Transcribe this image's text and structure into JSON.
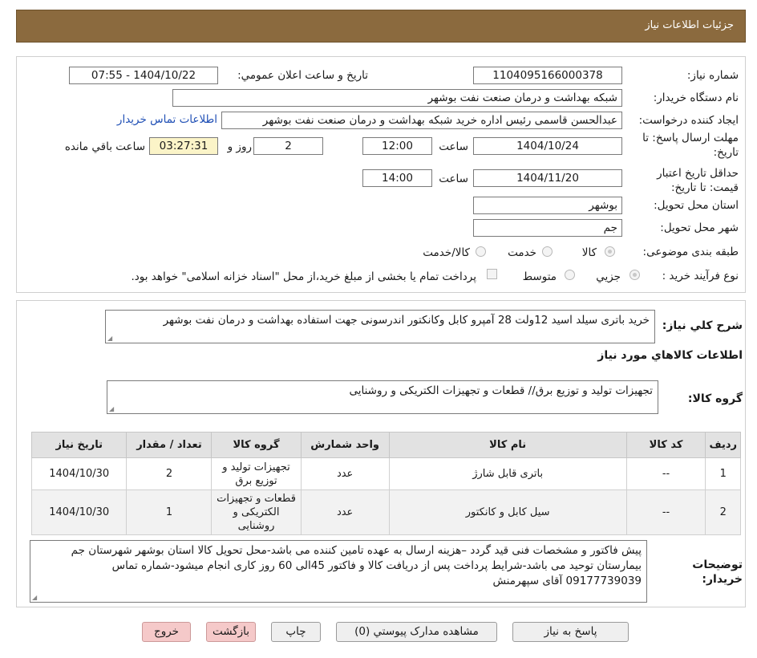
{
  "header": {
    "title": "جزئیات اطلاعات نیاز"
  },
  "form": {
    "need_number_label": "شماره نیاز:",
    "need_number": "1104095166000378",
    "announce_label": "تاريخ و ساعت اعلان عمومي:",
    "announce_value": "1404/10/22 - 07:55",
    "buyer_org_label": "نام دستگاه خريدار:",
    "buyer_org": "شبکه بهداشت و درمان صنعت نفت بوشهر",
    "creator_label": "ايجاد کننده درخواست:",
    "creator": "عبدالحسن قاسمی رئیس اداره خرید  شبکه بهداشت و درمان صنعت نفت بوشهر",
    "contact_link": "اطلاعات تماس خریدار",
    "deadline_label": "مهلت ارسال پاسخ: تا تاريخ:",
    "deadline_date": "1404/10/24",
    "time_label": "ساعت",
    "deadline_time": "12:00",
    "days_value": "2",
    "days_label": "روز و",
    "remaining_time": "03:27:31",
    "remaining_label": "ساعت باقي مانده",
    "validity_label": "حداقل تاريخ اعتبار قيمت: تا تاريخ:",
    "validity_date": "1404/11/20",
    "validity_time": "14:00",
    "province_label": "استان محل تحويل:",
    "province": "بوشهر",
    "city_label": "شهر محل تحويل:",
    "city": "جم",
    "category_label": "طبقه بندی موضوعی:",
    "category_options": [
      "کالا",
      "خدمت",
      "کالا/خدمت"
    ],
    "process_label": "نوع فرآیند خرید :",
    "process_options": [
      "جزیي",
      "متوسط"
    ],
    "payment_note": "پرداخت تمام یا بخشی از مبلغ خرید،از محل \"اسناد خزانه اسلامی\" خواهد بود."
  },
  "summary": {
    "label": "شرح كلي نياز:",
    "text": "خرید باتری سیلد اسید 12ولت 28 آمپرو کابل وکانکتور اندرسونی جهت استفاده بهداشت و درمان نفت بوشهر"
  },
  "goods": {
    "section_title": "اطلاعات كالاهاي مورد نياز",
    "group_label": "گروه کالا:",
    "group_text": "تجهیزات تولید و توزیع برق// قطعات و تجهیزات الکتریکی و روشنایی",
    "columns": [
      "رديف",
      "کد کالا",
      "نام کالا",
      "واحد شمارش",
      "گروه کالا",
      "تعداد / مقدار",
      "تاریخ نیاز"
    ],
    "rows": [
      {
        "row": "1",
        "code": "--",
        "name": "باتری قابل شارژ",
        "unit": "عدد",
        "group": "تجهیزات تولید و توزیع برق",
        "qty": "2",
        "date": "1404/10/30"
      },
      {
        "row": "2",
        "code": "--",
        "name": "سیل کابل و کانکتور",
        "unit": "عدد",
        "group": "قطعات و تجهیزات الکتریکی و روشنایی",
        "qty": "1",
        "date": "1404/10/30"
      }
    ]
  },
  "notes": {
    "label": "توضیحات خریدار:",
    "text": "پیش فاکتور و مشخصات فنی قید گردد –هزینه ارسال به عهده تامین کننده می باشد-محل تحویل کالا استان بوشهر شهرستان جم بیمارستان توحید می باشد-شرایط پرداخت پس از دریافت کالا و فاکتور 45الی 60 روز کاری انجام میشود-شماره تماس 09177739039 آقای سپهرمنش"
  },
  "buttons": {
    "reply": "پاسخ به نیاز",
    "attachments": "مشاهده مدارک پیوستي (0)",
    "print": "چاپ",
    "back": "بازگشت",
    "exit": "خروج"
  },
  "watermark": {
    "text": "AriaTender.neT"
  },
  "colors": {
    "header_bg": "#8b6a3e",
    "link": "#1f4fb5",
    "remaining_bg": "#fbf4c8",
    "pink_button": "#f5c9c9"
  }
}
